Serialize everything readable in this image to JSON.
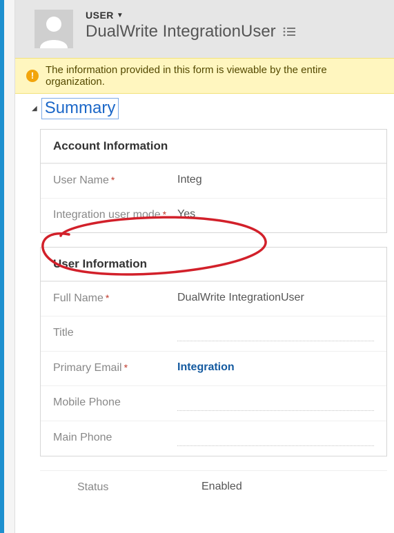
{
  "header": {
    "entity_label": "USER",
    "record_name": "DualWrite IntegrationUser"
  },
  "infobar": {
    "message": "The information provided in this form is viewable by the entire organization."
  },
  "summary": {
    "title": "Summary"
  },
  "account_info": {
    "title": "Account Information",
    "user_name_label": "User Name",
    "user_name_value": "Integ",
    "integration_mode_label": "Integration user mode",
    "integration_mode_value": "Yes"
  },
  "user_info": {
    "title": "User Information",
    "full_name_label": "Full Name",
    "full_name_value": "DualWrite IntegrationUser",
    "title_label": "Title",
    "title_value": "",
    "primary_email_label": "Primary Email",
    "primary_email_value": "Integration",
    "mobile_phone_label": "Mobile Phone",
    "mobile_phone_value": "",
    "main_phone_label": "Main Phone",
    "main_phone_value": ""
  },
  "status": {
    "label": "Status",
    "value": "Enabled"
  }
}
